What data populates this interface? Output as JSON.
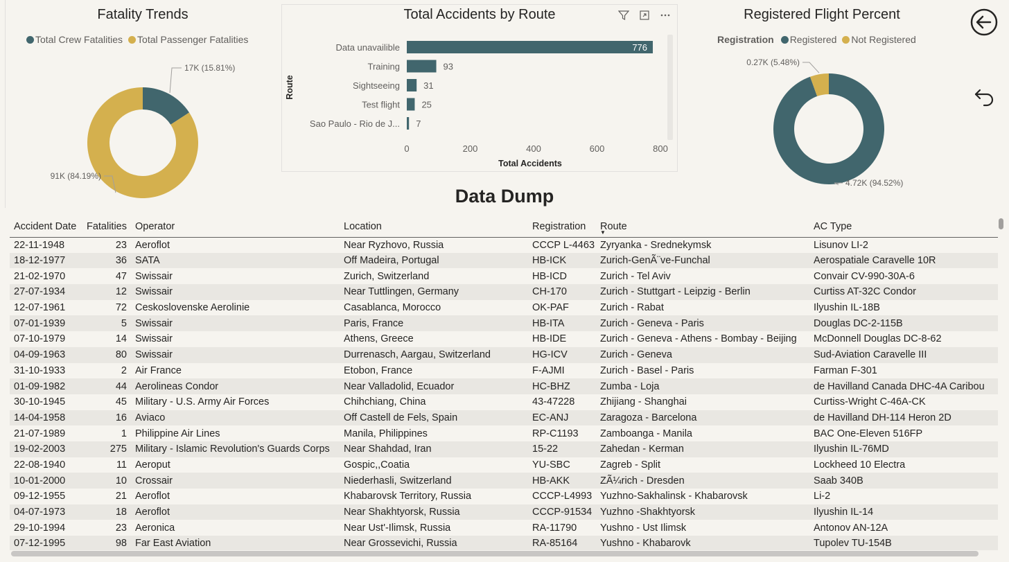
{
  "fatality_panel": {
    "title": "Fatality Trends",
    "legend": [
      {
        "label": "Total Crew Fatalities",
        "color": "#41666d"
      },
      {
        "label": "Total Passenger Fatalities",
        "color": "#d4b04e"
      }
    ],
    "labels": {
      "crew": "17K (15.81%)",
      "passenger": "91K (84.19%)"
    }
  },
  "registered_panel": {
    "title": "Registered Flight Percent",
    "legend_title": "Registration",
    "legend": [
      {
        "label": "Registered",
        "color": "#41666d"
      },
      {
        "label": "Not Registered",
        "color": "#d4b04e"
      }
    ],
    "labels": {
      "not_registered": "0.27K (5.48%)",
      "registered": "4.72K (94.52%)"
    }
  },
  "route_panel": {
    "title": "Total Accidents by Route",
    "toolbar": {
      "filter_icon": "filter-icon",
      "focus_icon": "focus-mode-icon",
      "more_icon": "more-options-icon"
    }
  },
  "chart_data": [
    {
      "type": "pie",
      "title": "Fatality Trends",
      "donut": true,
      "categories": [
        "Total Crew Fatalities",
        "Total Passenger Fatalities"
      ],
      "values": [
        15.81,
        84.19
      ],
      "data_labels": [
        "17K (15.81%)",
        "91K (84.19%)"
      ],
      "colors": [
        "#41666d",
        "#d4b04e"
      ],
      "legend": "top"
    },
    {
      "type": "bar",
      "orientation": "horizontal",
      "title": "Total Accidents by Route",
      "categories": [
        "Data unavailible",
        "Training",
        "Sightseeing",
        "Test flight",
        "Sao Paulo - Rio de J..."
      ],
      "values": [
        776,
        93,
        31,
        25,
        7
      ],
      "xlabel": "Total Accidents",
      "ylabel": "Route",
      "xticks": [
        "0",
        "200",
        "400",
        "600",
        "800"
      ],
      "xlim": [
        0,
        800
      ],
      "color": "#41666d"
    },
    {
      "type": "pie",
      "title": "Registered Flight Percent",
      "donut": true,
      "categories": [
        "Registered",
        "Not Registered"
      ],
      "values": [
        94.52,
        5.48
      ],
      "data_labels": [
        "4.72K (94.52%)",
        "0.27K (5.48%)"
      ],
      "colors": [
        "#41666d",
        "#d4b04e"
      ],
      "legend": "top"
    }
  ],
  "nav": {
    "back_icon": "back-arrow-icon",
    "undo_icon": "undo-icon"
  },
  "data_dump": {
    "title": "Data Dump",
    "columns": [
      "Accident Date",
      "Fatalities",
      "Operator",
      "Location",
      "Registration",
      "Route",
      "AC Type"
    ],
    "rows": [
      [
        "22-11-1948",
        "23",
        "Aeroflot",
        "Near Ryzhovo, Russia",
        "CCCP L-4463",
        "Zyryanka - Srednekymsk",
        "Lisunov LI-2"
      ],
      [
        "18-12-1977",
        "36",
        "SATA",
        "Off Madeira, Portugal",
        "HB-ICK",
        "Zurich-GenÃ¨ve-Funchal",
        "Aerospatiale Caravelle 10R"
      ],
      [
        "21-02-1970",
        "47",
        "Swissair",
        "Zurich, Switzerland",
        "HB-ICD",
        "Zurich - Tel Aviv",
        "Convair CV-990-30A-6"
      ],
      [
        "27-07-1934",
        "12",
        "Swissair",
        "Near Tuttlingen, Germany",
        "CH-170",
        "Zurich - Stuttgart - Leipzig - Berlin",
        "Curtiss AT-32C Condor"
      ],
      [
        "12-07-1961",
        "72",
        "Ceskoslovenske Aerolinie",
        "Casablanca, Morocco",
        "OK-PAF",
        "Zurich - Rabat",
        "Ilyushin IL-18B"
      ],
      [
        "07-01-1939",
        "5",
        "Swissair",
        "Paris, France",
        "HB-ITA",
        "Zurich - Geneva - Paris",
        "Douglas DC-2-115B"
      ],
      [
        "07-10-1979",
        "14",
        "Swissair",
        "Athens, Greece",
        "HB-IDE",
        "Zurich - Geneva - Athens - Bombay - Beijing",
        "McDonnell Douglas DC-8-62"
      ],
      [
        "04-09-1963",
        "80",
        "Swissair",
        "Durrenasch, Aargau, Switzerland",
        "HG-ICV",
        "Zurich - Geneva",
        "Sud-Aviation Caravelle III"
      ],
      [
        "31-10-1933",
        "2",
        "Air France",
        "Etobon, France",
        "F-AJMI",
        "Zurich - Basel - Paris",
        "Farman F-301"
      ],
      [
        "01-09-1982",
        "44",
        "Aerolineas Condor",
        "Near Valladolid, Ecuador",
        "HC-BHZ",
        "Zumba - Loja",
        "de Havilland Canada DHC-4A Caribou"
      ],
      [
        "30-10-1945",
        "45",
        "Military - U.S. Army Air Forces",
        "Chihchiang, China",
        "43-47228",
        "Zhijiang - Shanghai",
        "Curtiss-Wright C-46A-CK"
      ],
      [
        "14-04-1958",
        "16",
        "Aviaco",
        "Off Castell de Fels, Spain",
        "EC-ANJ",
        "Zaragoza - Barcelona",
        "de Havilland DH-114 Heron 2D"
      ],
      [
        "21-07-1989",
        "1",
        "Philippine Air Lines",
        "Manila, Philippines",
        "RP-C1193",
        "Zamboanga - Manila",
        "BAC One-Eleven 516FP"
      ],
      [
        "19-02-2003",
        "275",
        "Military - Islamic Revolution's Guards Corps",
        "Near Shahdad, Iran",
        "15-22",
        "Zahedan - Kerman",
        "Ilyushin IL-76MD"
      ],
      [
        "22-08-1940",
        "11",
        "Aeroput",
        "Gospic,,Coatia",
        "YU-SBC",
        "Zagreb - Split",
        "Lockheed 10 Electra"
      ],
      [
        "10-01-2000",
        "10",
        "Crossair",
        "Niederhasli, Switzerland",
        "HB-AKK",
        "ZÃ¼rich - Dresden",
        "Saab 340B"
      ],
      [
        "09-12-1955",
        "21",
        "Aeroflot",
        "Khabarovsk Territory, Russia",
        "CCCP-L4993",
        "Yuzhno-Sakhalinsk - Khabarovsk",
        "Li-2"
      ],
      [
        "04-07-1973",
        "18",
        "Aeroflot",
        "Near Shakhtyorsk, Russia",
        "CCCP-91534",
        "Yuzhno -Shakhtyorsk",
        "Ilyushin IL-14"
      ],
      [
        "29-10-1994",
        "23",
        "Aeronica",
        "Near Ust'-Ilimsk, Russia",
        "RA-11790",
        "Yushno - Ust Ilimsk",
        "Antonov AN-12A"
      ],
      [
        "07-12-1995",
        "98",
        "Far East Aviation",
        "Near Grossevichi, Russia",
        "RA-85164",
        "Yushno - Khabarovk",
        "Tupolev TU-154B"
      ]
    ]
  }
}
